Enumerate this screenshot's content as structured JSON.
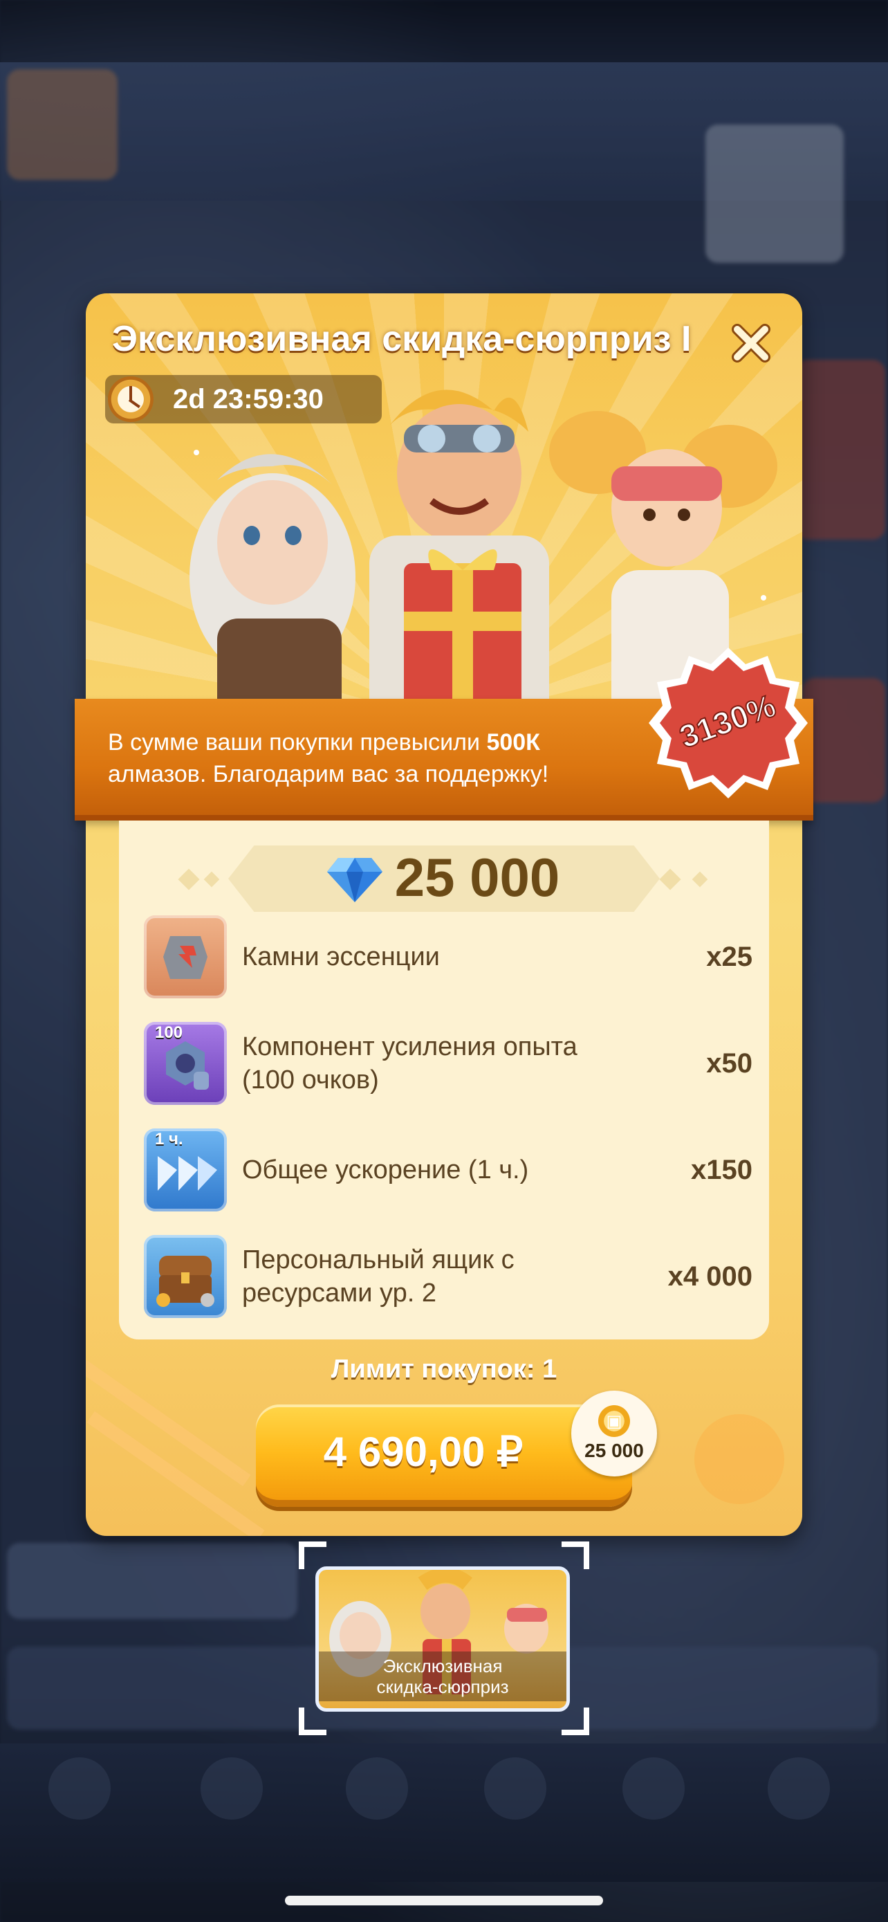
{
  "offer": {
    "title": "Эксклюзивная скидка-сюрприз I",
    "timer": "2d 23:59:30",
    "banner": {
      "line1_prefix": "В сумме ваши покупки превысили ",
      "line1_bold": "500К",
      "line2": "алмазов. Благодарим вас за поддержку!"
    },
    "discount": "3130%",
    "gems": "25 000",
    "items": [
      {
        "name_line1": "Камни эссенции",
        "name_line2": "",
        "qty": "x25",
        "icon": "essence-stone-icon",
        "tag": ""
      },
      {
        "name_line1": "Компонент усиления опыта",
        "name_line2": "(100 очков)",
        "qty": "x50",
        "icon": "exp-boost-component-icon",
        "tag": "100"
      },
      {
        "name_line1": "Общее ускорение (1 ч.)",
        "name_line2": "",
        "qty": "x150",
        "icon": "speedup-icon",
        "tag": "1 ч."
      },
      {
        "name_line1": "Персональный ящик с",
        "name_line2": "ресурсами ур. 2",
        "qty": "x4 000",
        "icon": "resource-chest-icon",
        "tag": ""
      }
    ],
    "purchase_limit": "Лимит покупок: 1",
    "price": "4 690,00 ₽",
    "bonus": "25 000"
  },
  "thumbnail": {
    "label_line1": "Эксклюзивная",
    "label_line2": "скидка-сюрприз"
  },
  "colors": {
    "panel": "#f8cf63",
    "banner": "#db7510",
    "button": "#ffbb1c",
    "badge": "#d9483c"
  }
}
